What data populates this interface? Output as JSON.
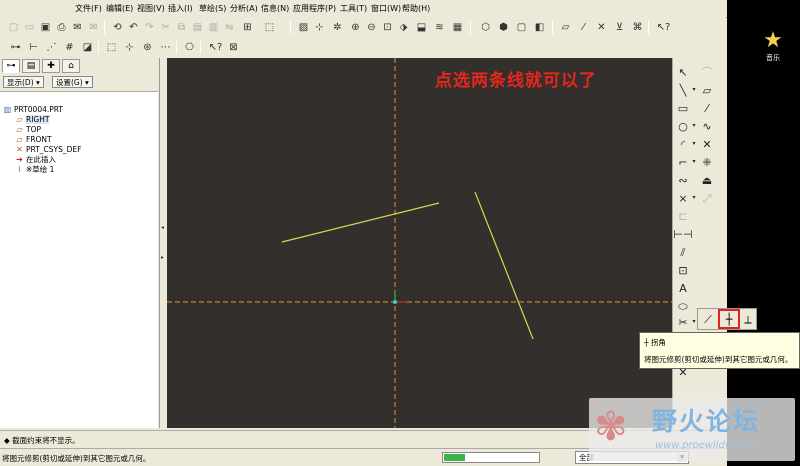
{
  "menu": [
    "文件(F)",
    "编辑(E)",
    "视图(V)",
    "插入(I)",
    "草绘(S)",
    "分析(A)",
    "信息(N)",
    "应用程序(P)",
    "工具(T)",
    "窗口(W)",
    "帮助(H)"
  ],
  "left_panel": {
    "show_dropdown": "显示(D) ▾",
    "settings_dropdown": "设置(G) ▾",
    "tree": [
      {
        "label": "PRT0004.PRT",
        "icon": "part-icon"
      },
      {
        "label": "RIGHT",
        "icon": "datum-plane-icon"
      },
      {
        "label": "TOP",
        "icon": "datum-plane-icon"
      },
      {
        "label": "FRONT",
        "icon": "datum-plane-icon"
      },
      {
        "label": "PRT_CSYS_DEF",
        "icon": "csys-icon"
      },
      {
        "label": "在此插入",
        "icon": "insert-here-icon"
      },
      {
        "label": "※草绘 1",
        "icon": "sketch-icon"
      }
    ]
  },
  "canvas": {
    "hint": "点选两条线就可以了",
    "background": "#332f2c",
    "line_color": "#d8d84a",
    "axis_color": "#e0963a"
  },
  "tooltip": {
    "title": "拐角",
    "description": "将图元修剪(剪切或延伸)到其它图元或几何。"
  },
  "message": "◆ 截面约束将不显示。",
  "status": {
    "text": "将图元修剪(剪切或延伸)到其它图元或几何。",
    "progress": 0.22,
    "filter": "全部"
  },
  "desktop": {
    "icon_label": "音乐"
  },
  "watermark": {
    "name": "野火论坛",
    "url": "www.proewildfire.cn"
  },
  "colors": {
    "highlight": "#e0241b",
    "progress": "#3bb34a"
  }
}
